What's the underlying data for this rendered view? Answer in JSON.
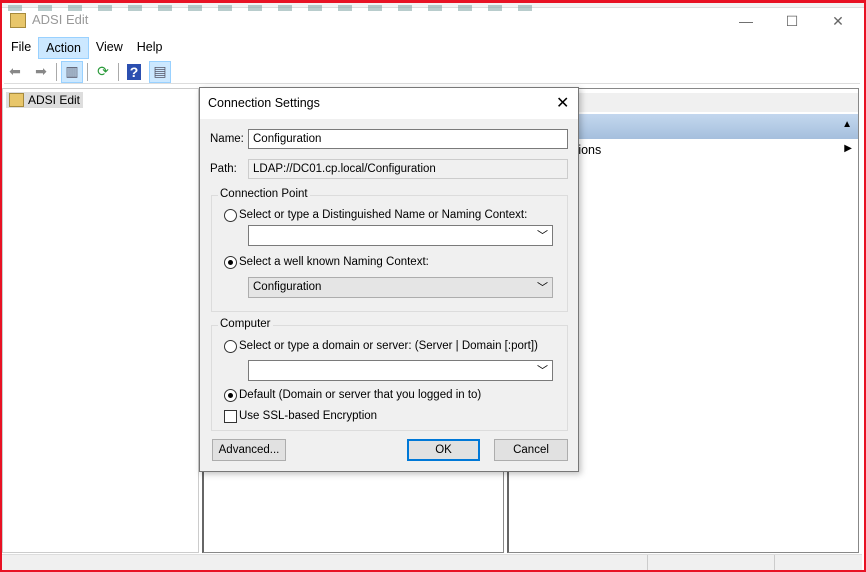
{
  "window": {
    "title": "ADSI Edit",
    "minimize": "—",
    "maximize": "☐",
    "close": "✕"
  },
  "menu": [
    "File",
    "Action",
    "View",
    "Help"
  ],
  "toolbar": {
    "back": "back-arrow",
    "forward": "forward-arrow",
    "show_tree": "console-tree",
    "refresh": "refresh",
    "help": "?",
    "show_action": "action-pane"
  },
  "tree": {
    "root": "ADSI Edit"
  },
  "actions_pane": {
    "item": "More Actions"
  },
  "dialog": {
    "title": "Connection Settings",
    "name_label": "Name:",
    "name_value": "Configuration",
    "path_label": "Path:",
    "path_value": "LDAP://DC01.cp.local/Configuration",
    "connection_point": {
      "legend": "Connection Point",
      "option_dn": "Select or type a Distinguished Name or Naming Context:",
      "dn_value": "",
      "option_known": "Select a well known Naming Context:",
      "known_value": "Configuration"
    },
    "computer": {
      "legend": "Computer",
      "option_server": "Select or type a domain or server: (Server | Domain [:port])",
      "server_value": "",
      "option_default": "Default (Domain or server that you logged in to)",
      "ssl_label": "Use SSL-based Encryption"
    },
    "advanced": "Advanced...",
    "ok": "OK",
    "cancel": "Cancel"
  },
  "colors": {
    "accent": "#0078d7",
    "frame": "#e81123",
    "action_header": "#b3cbe6"
  }
}
